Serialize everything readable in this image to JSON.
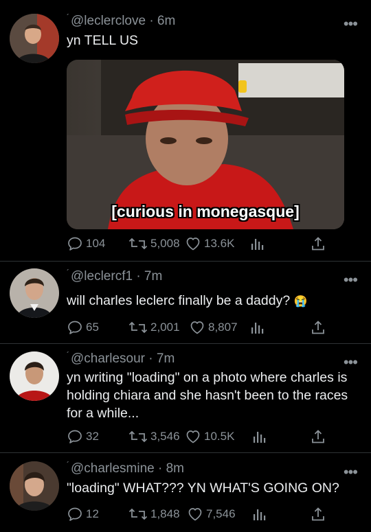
{
  "tweets": [
    {
      "handle": "@leclerclove",
      "time": "· 6m",
      "text": "yn TELL US",
      "media_caption": "[curious in monegasque]",
      "replies": "104",
      "retweets": "5,008",
      "likes": "13.6K"
    },
    {
      "handle": "@leclercf1",
      "time": "· 7m",
      "text": "will charles leclerc finally be a daddy?",
      "emoji": "😭",
      "replies": "65",
      "retweets": "2,001",
      "likes": "8,807"
    },
    {
      "handle": "@charlesour",
      "time": "· 7m",
      "text": "yn writing \"loading\" on a photo where charles is holding chiara and she hasn't been to the races for a while...",
      "replies": "32",
      "retweets": "3,546",
      "likes": "10.5K"
    },
    {
      "handle": "@charlesmine",
      "time": "· 8m",
      "text": "\"loading\" WHAT??? YN WHAT'S GOING ON?",
      "replies": "12",
      "retweets": "1,848",
      "likes": "7,546"
    }
  ],
  "icons": {
    "reply": "reply-icon",
    "retweet": "retweet-icon",
    "like": "heart-icon",
    "analytics": "analytics-icon",
    "share": "share-icon",
    "more": "more-icon"
  },
  "colors": {
    "background": "#000000",
    "secondary_text": "#8b9298",
    "primary_text": "#e7e9ea",
    "divider": "#2f3336"
  }
}
